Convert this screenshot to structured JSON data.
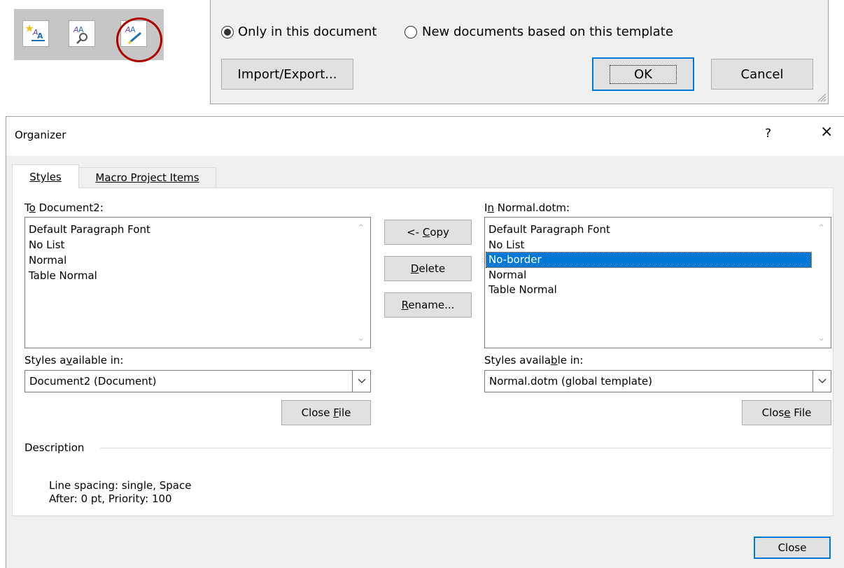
{
  "icon_strip": {
    "icons": [
      "new-style-icon",
      "style-inspector-icon",
      "manage-styles-icon"
    ],
    "highlight_color": "#b00000"
  },
  "save_options": {
    "radio_only": "Only in this document",
    "radio_new": "New documents based on this template",
    "selected": "radio_only",
    "import_export_label": "Import/Export...",
    "ok_label": "OK",
    "cancel_label": "Cancel"
  },
  "organizer": {
    "title": "Organizer",
    "help_glyph": "?",
    "close_glyph": "×",
    "tabs": [
      {
        "label": "Styles",
        "active": true
      },
      {
        "label": "Macro Project Items",
        "active": false
      }
    ],
    "left": {
      "header_pre": "T",
      "header_u": "o",
      "header_post": " Document2:",
      "items": [
        "Default Paragraph Font",
        "No List",
        "Normal",
        "Table Normal"
      ],
      "available_label_pre": "Styles a",
      "available_label_u": "v",
      "available_label_post": "ailable in:",
      "available_value": "Document2 (Document)",
      "close_file_pre": "Close ",
      "close_file_u": "F",
      "close_file_post": "ile"
    },
    "right": {
      "header_pre": "I",
      "header_u": "n",
      "header_post": " Normal.dotm:",
      "items": [
        "Default Paragraph Font",
        "No List",
        "No-border",
        "Normal",
        "Table Normal"
      ],
      "selected_item": "No-border",
      "available_label_pre": "Styles availa",
      "available_label_u": "b",
      "available_label_post": "le in:",
      "available_value": "Normal.dotm (global template)",
      "close_file_pre": "Clos",
      "close_file_u": "e",
      "close_file_post": " File"
    },
    "buttons": {
      "copy_pre": "<- ",
      "copy_u": "C",
      "copy_post": "opy",
      "delete_u": "D",
      "delete_post": "elete",
      "rename_u": "R",
      "rename_post": "ename..."
    },
    "description_label": "Description",
    "description_line1": "Line spacing:  single, Space",
    "description_line2": "After:  0 pt, Priority: 100",
    "close_label": "Close",
    "accent_color": "#0078d7"
  }
}
